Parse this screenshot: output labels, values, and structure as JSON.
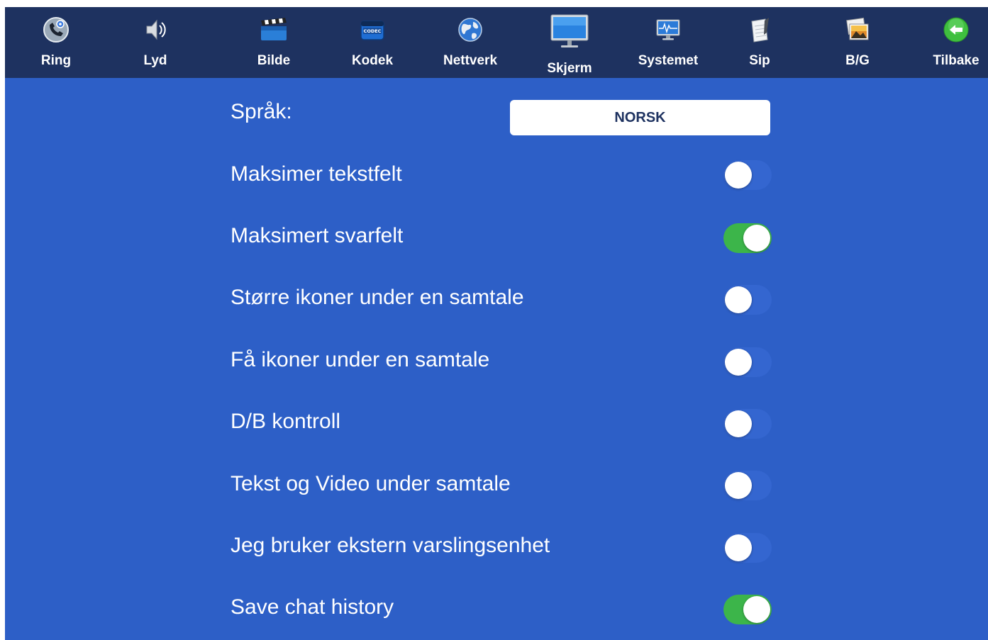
{
  "nav": {
    "items": [
      {
        "label": "Ring",
        "icon": "phone-gear-icon"
      },
      {
        "label": "Lyd",
        "icon": "speaker-icon"
      },
      {
        "label": "Bilde",
        "icon": "clapperboard-icon"
      },
      {
        "label": "Kodek",
        "icon": "codec-chip-icon",
        "icon_text": "CODEC"
      },
      {
        "label": "Nettverk",
        "icon": "globe-icon"
      },
      {
        "label": "Skjerm",
        "icon": "monitor-icon",
        "active": true
      },
      {
        "label": "Systemet",
        "icon": "system-monitor-icon"
      },
      {
        "label": "Sip",
        "icon": "notepad-icon"
      },
      {
        "label": "B/G",
        "icon": "pictures-icon"
      },
      {
        "label": "Tilbake",
        "icon": "back-arrow-icon"
      }
    ]
  },
  "settings": {
    "language_label": "Språk:",
    "language_value": "NORSK",
    "rows": [
      {
        "label": "Maksimer tekstfelt",
        "on": false
      },
      {
        "label": "Maksimert svarfelt",
        "on": true
      },
      {
        "label": "Større ikoner under en samtale",
        "on": false
      },
      {
        "label": "Få ikoner under en samtale",
        "on": false
      },
      {
        "label": "D/B kontroll",
        "on": false
      },
      {
        "label": "Tekst og Video under samtale",
        "on": false
      },
      {
        "label": "Jeg bruker ekstern varslingsenhet",
        "on": false
      },
      {
        "label": "Save chat history",
        "on": true
      }
    ]
  },
  "colors": {
    "background": "#2d5fc7",
    "topbar": "#1e3260",
    "toggle_on": "#3cb54a",
    "toggle_off": "#3466d0"
  }
}
